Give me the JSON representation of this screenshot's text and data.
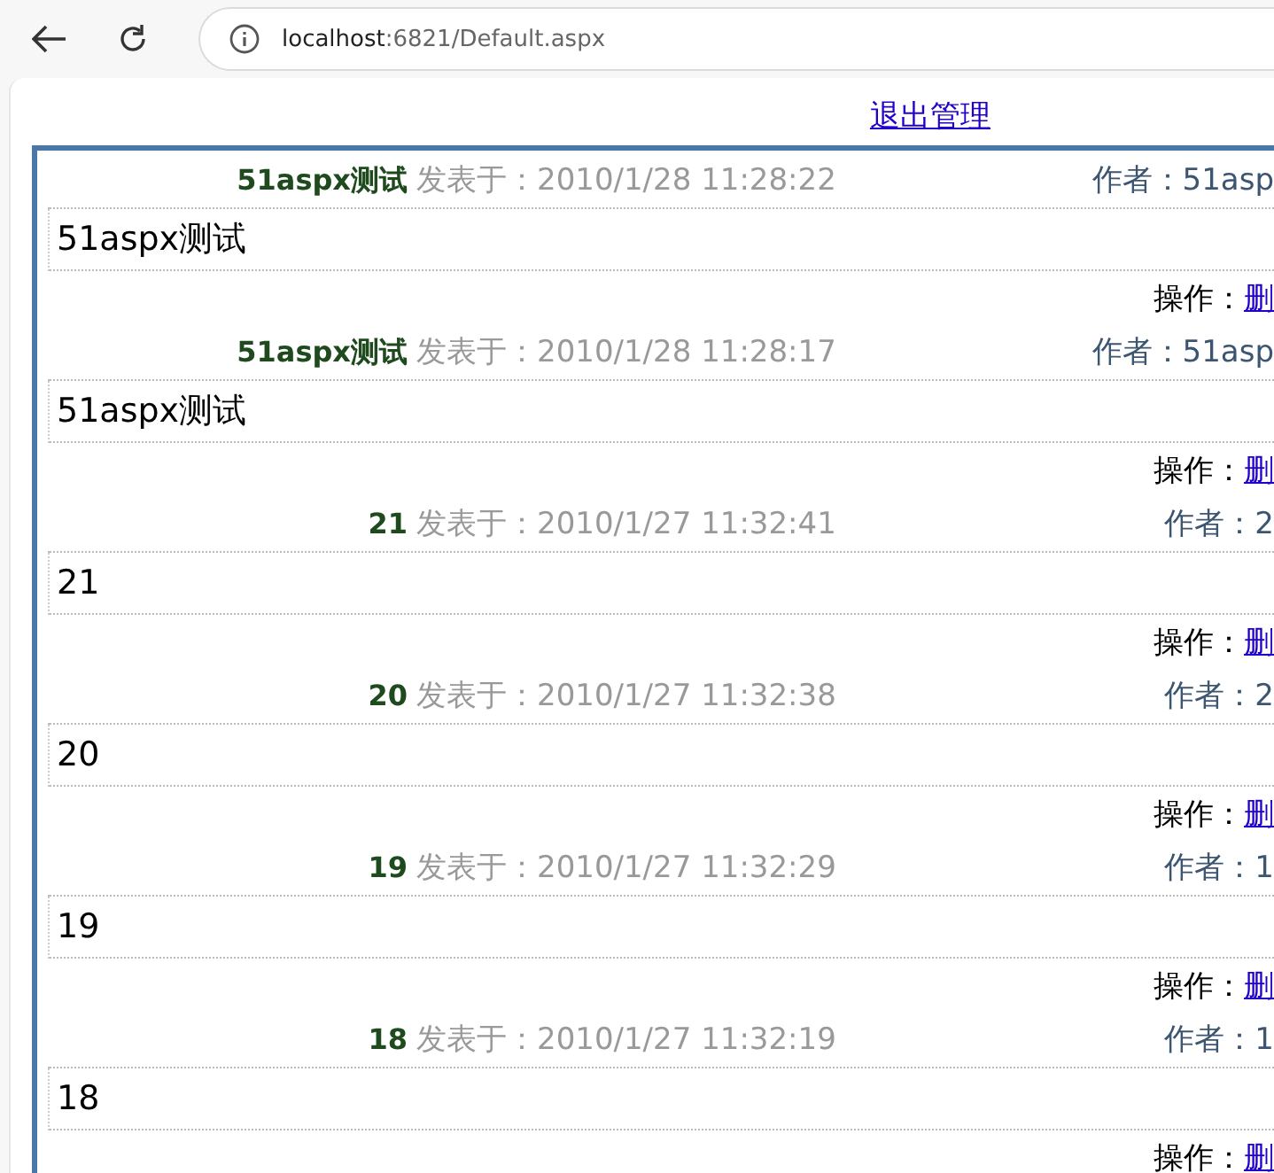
{
  "browser": {
    "url_host": "localhost",
    "url_path": ":6821/Default.aspx"
  },
  "logout_link": "退出管理",
  "posts": [
    {
      "title": "51aspx测试",
      "posted_label": "发表于：",
      "date": "2010/1/28 11:28:22",
      "author": "作者：51asp",
      "body": "51aspx测试",
      "op_label": "操作：",
      "op_link": "删"
    },
    {
      "title": "51aspx测试",
      "posted_label": "发表于：",
      "date": "2010/1/28 11:28:17",
      "author": "作者：51asp",
      "body": "51aspx测试",
      "op_label": "操作：",
      "op_link": "删"
    },
    {
      "title": "21",
      "posted_label": "发表于：",
      "date": "2010/1/27 11:32:41",
      "author": "作者：2",
      "body": "21",
      "op_label": "操作：",
      "op_link": "删"
    },
    {
      "title": "20",
      "posted_label": "发表于：",
      "date": "2010/1/27 11:32:38",
      "author": "作者：2",
      "body": "20",
      "op_label": "操作：",
      "op_link": "删"
    },
    {
      "title": "19",
      "posted_label": "发表于：",
      "date": "2010/1/27 11:32:29",
      "author": "作者：1",
      "body": "19",
      "op_label": "操作：",
      "op_link": "删"
    },
    {
      "title": "18",
      "posted_label": "发表于：",
      "date": "2010/1/27 11:32:19",
      "author": "作者：1",
      "body": "18",
      "op_label": "操作：",
      "op_link": "删"
    }
  ]
}
